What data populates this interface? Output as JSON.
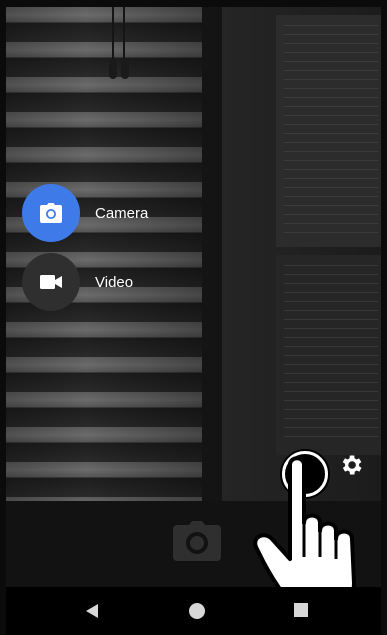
{
  "modes": {
    "camera": {
      "label": "Camera",
      "icon": "camera-icon",
      "color": "#3f7be8"
    },
    "video": {
      "label": "Video",
      "icon": "videocam-icon",
      "color": "#2f2f2f"
    }
  },
  "controls": {
    "settings_icon": "gear-icon",
    "shutter_icon": "camera-shutter-icon",
    "tap_indicator": "hand-pointer-icon"
  },
  "nav": {
    "back_icon": "back-triangle-icon",
    "home_icon": "home-circle-icon",
    "recents_icon": "recents-square-icon"
  }
}
